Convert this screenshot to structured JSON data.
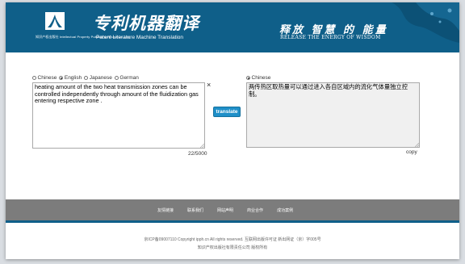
{
  "header": {
    "brand_cn": "专利机器翻译",
    "brand_en": "Patent Literature Machine Translation",
    "org_text": "知识产权出版社 Intellectual Property Publishing House Co.,Ltd",
    "slogan_cn": "释放 智慧 的 能量",
    "slogan_en": "RELEASE THE ENERGY OF WISDOM"
  },
  "source": {
    "languages": [
      "Chinese",
      "English",
      "Japanese",
      "German"
    ],
    "selected": "English",
    "text": "heating amount of the two heat transmission zones can be controlled independently through amount of the fluidization gas entering respective zone .",
    "clear_label": "×",
    "char_count": "22/5000"
  },
  "translate_label": "translate",
  "target": {
    "language": "Chinese",
    "text": "两传热区取热量可以通过进入各自区域内的流化气体量独立控制。",
    "copy_label": "copy"
  },
  "nav": {
    "links": [
      "友情链接",
      "联系我们",
      "网站声明",
      "商业合作",
      "成功案例"
    ]
  },
  "footer": {
    "line1": "京ICP备09007110 Copyright ipph.cn All rights reserved. 互联网出版许可证 新出网证（京）字005号",
    "line2": "知识产权出版社有限责任公司 版权所有"
  },
  "colors": {
    "header_bg": "#0f5f89",
    "button_bg": "#1f8fc8",
    "nav_bg": "#7c7c7c"
  }
}
